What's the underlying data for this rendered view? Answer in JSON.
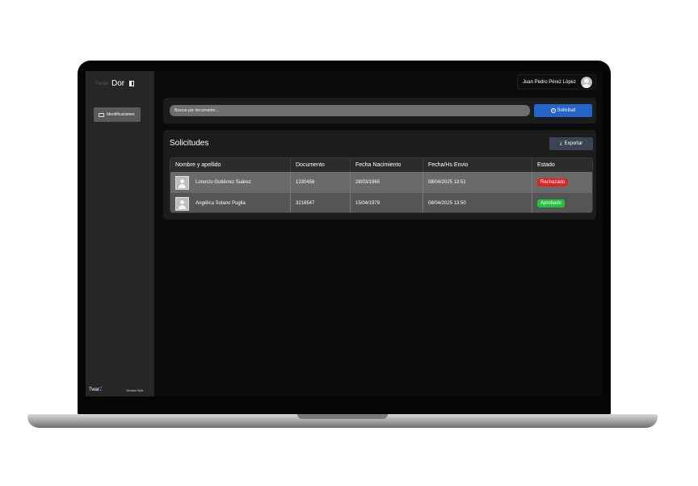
{
  "sidebar": {
    "brand_mark": "Parga",
    "brand_name": "Dor",
    "nav_items": [
      {
        "label": "Identificaciones"
      }
    ],
    "footer_brand_prefix": "Twar",
    "footer_brand_suffix": "Z",
    "version": "Version N/A"
  },
  "header": {
    "user_name": "Juan Pedro Pérez López"
  },
  "search": {
    "placeholder": "Buscar por documento...",
    "button_label": "Solicitud"
  },
  "panel": {
    "title": "Solicitudes",
    "export_label": "Exportar",
    "columns": [
      "Nombre y apellido",
      "Documento",
      "Fecha Nacimiento",
      "Fecha/Hs Envio",
      "Estado"
    ],
    "rows": [
      {
        "name": "Lorenzo Gutiérrez Suárez",
        "documento": "1230456",
        "nacimiento": "28/03/1965",
        "envio": "08/04/2025 13:51",
        "estado": "Rechazado"
      },
      {
        "name": "Angélica Solano Puglia",
        "documento": "3216547",
        "nacimiento": "15/04/1978",
        "envio": "08/04/2025 13:50",
        "estado": "Aprobado"
      }
    ]
  },
  "colors": {
    "accent": "#2465c9",
    "rejected": "#e02424",
    "approved": "#22c53a",
    "brand_accent": "#3d8bff"
  }
}
